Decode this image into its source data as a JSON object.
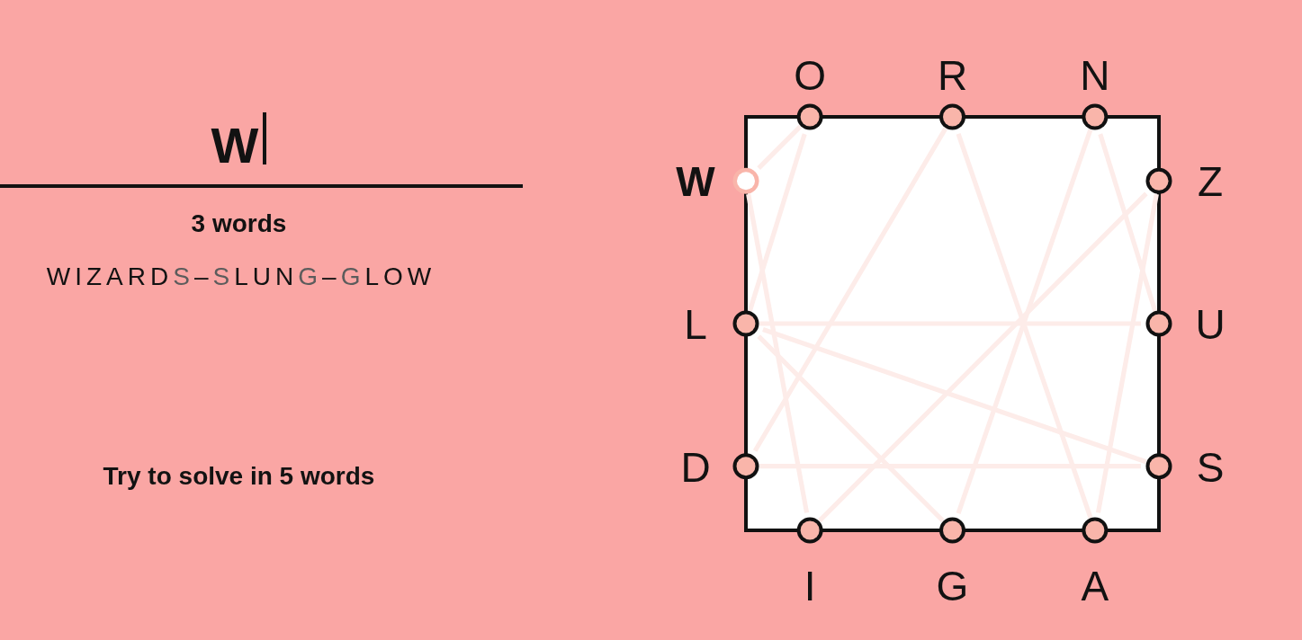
{
  "entry": {
    "value": "W"
  },
  "found": {
    "count_label": "3 words",
    "words": [
      "WIZARDS",
      "SLUNG",
      "GLOW"
    ],
    "separator": "–"
  },
  "goal": "Try to solve in 5 words",
  "board": {
    "sides": [
      {
        "kind": "top",
        "letters": [
          {
            "letter": "O",
            "selected": false
          },
          {
            "letter": "R",
            "selected": false
          },
          {
            "letter": "N",
            "selected": false
          }
        ]
      },
      {
        "kind": "right",
        "letters": [
          {
            "letter": "Z",
            "selected": false
          },
          {
            "letter": "U",
            "selected": false
          },
          {
            "letter": "S",
            "selected": false
          }
        ]
      },
      {
        "kind": "bottom",
        "letters": [
          {
            "letter": "I",
            "selected": false
          },
          {
            "letter": "G",
            "selected": false
          },
          {
            "letter": "A",
            "selected": false
          }
        ]
      },
      {
        "kind": "left",
        "letters": [
          {
            "letter": "W",
            "selected": true
          },
          {
            "letter": "L",
            "selected": false
          },
          {
            "letter": "D",
            "selected": false
          }
        ]
      }
    ]
  }
}
